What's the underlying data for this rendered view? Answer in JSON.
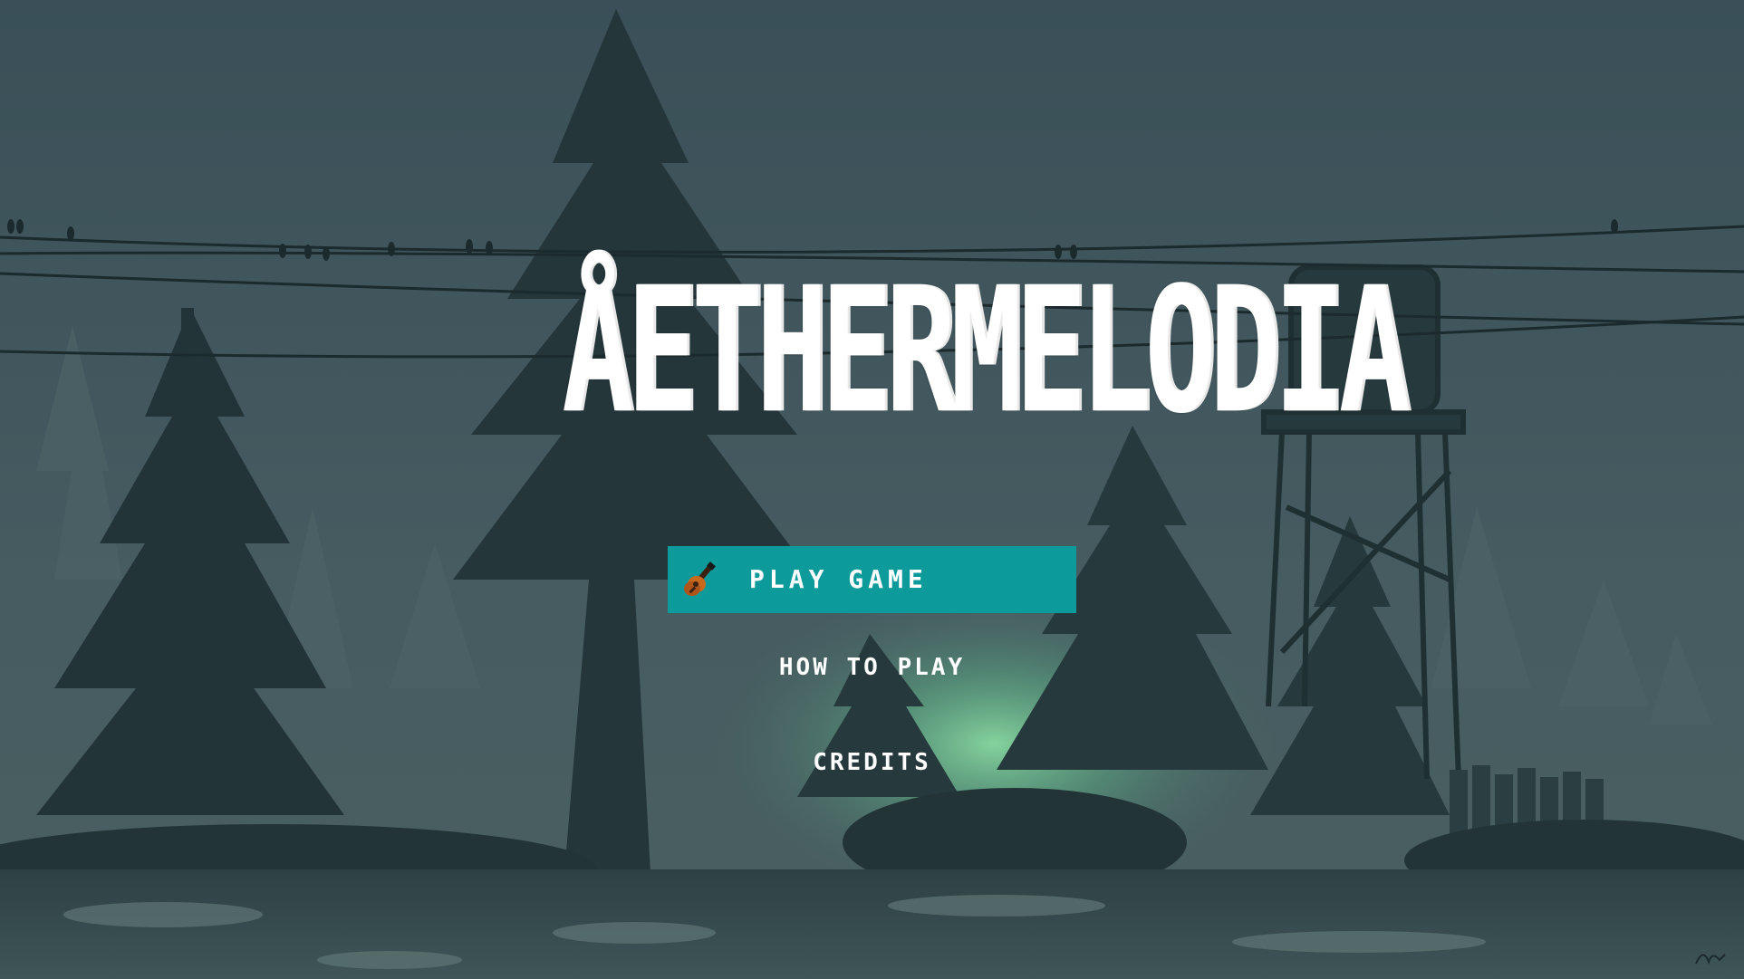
{
  "menu": {
    "title": "ÅETHERMELODIA",
    "play_label": "PLAY GAME",
    "how_to_play_label": "HOW TO PLAY",
    "credits_label": "CREDITS"
  },
  "icons": {
    "play": "guitar-icon"
  },
  "colors": {
    "button_bg": "#0c9a9a",
    "text": "#ffffff",
    "sky": "#3d5258",
    "forest": "#1f2f33",
    "glow": "#7fe0a0"
  }
}
